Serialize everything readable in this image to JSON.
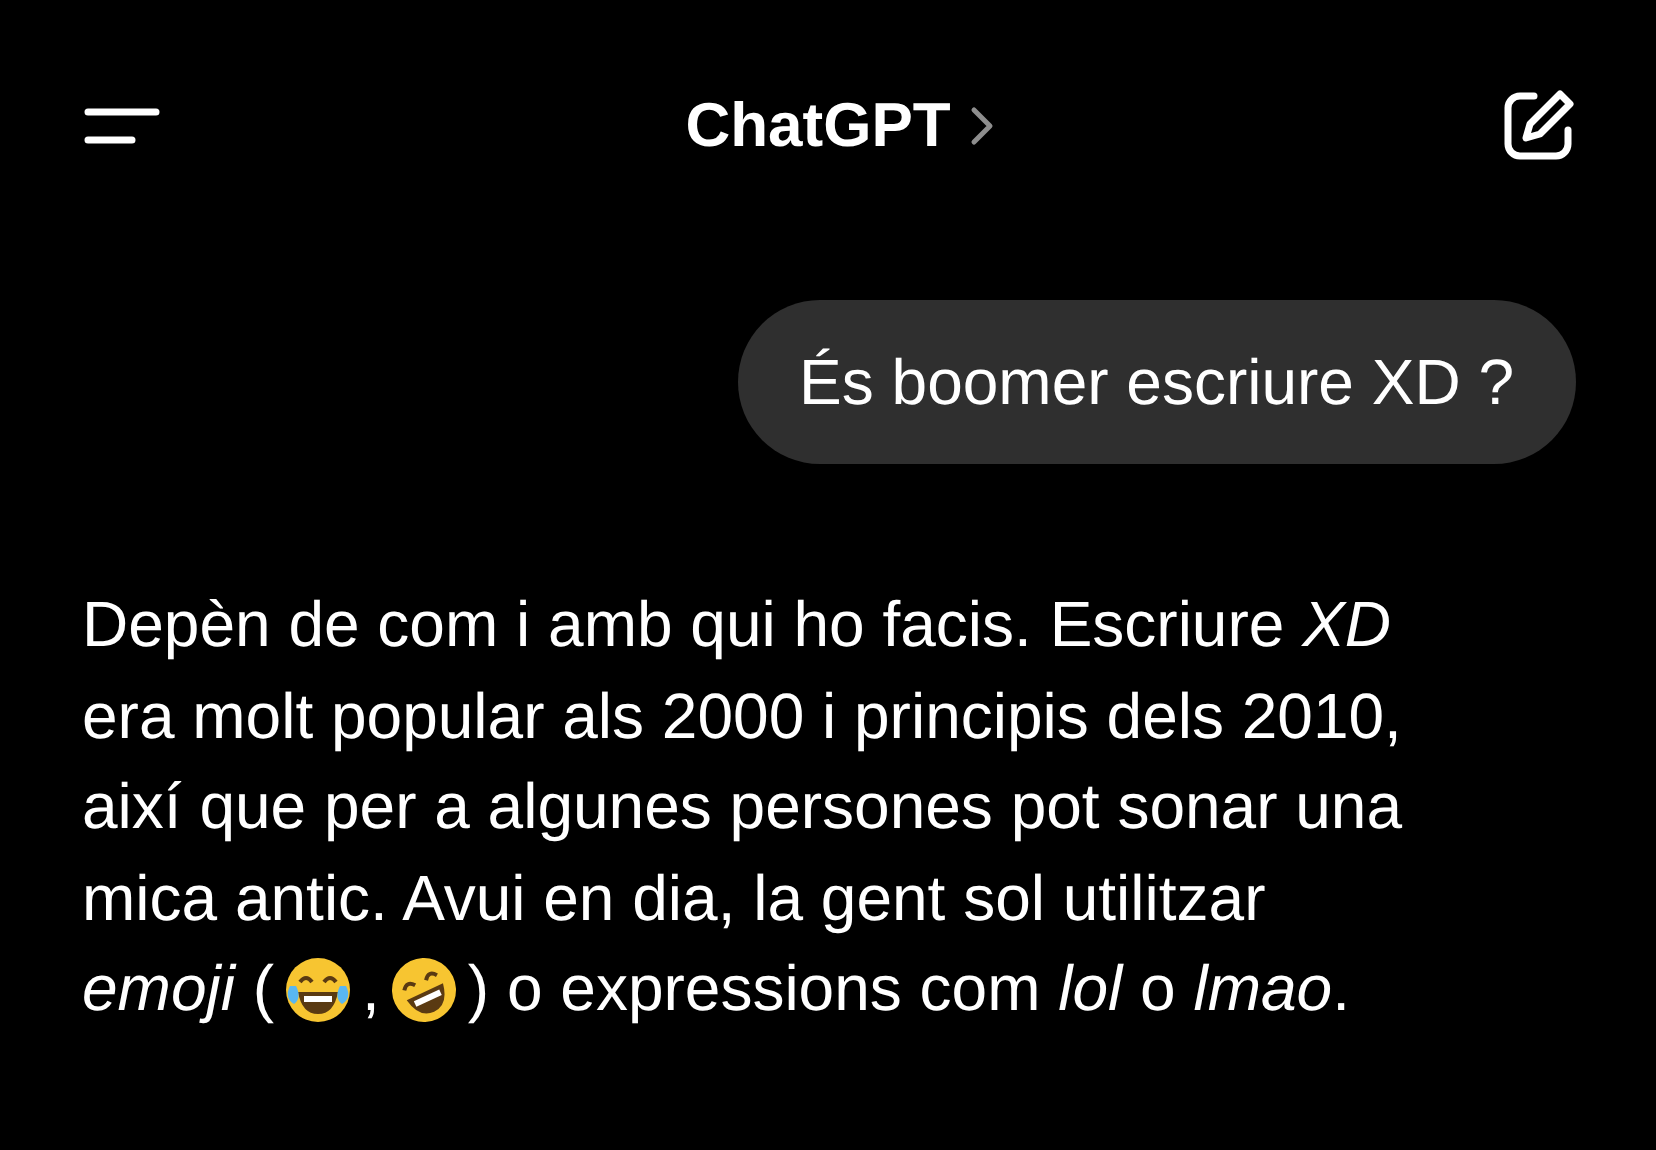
{
  "header": {
    "title": "ChatGPT"
  },
  "messages": [
    {
      "kind": "user",
      "text": "És boomer escriure XD ?"
    },
    {
      "kind": "assistant",
      "lines": [
        [
          {
            "kind": "text",
            "text": "Depèn de com i amb qui ho facis. Escriure *XD*"
          }
        ],
        [
          {
            "kind": "text",
            "text": "era molt popular als 2000 i principis dels 2010,"
          }
        ],
        [
          {
            "kind": "text",
            "text": "així que per a algunes persones pot sonar una"
          }
        ],
        [
          {
            "kind": "text",
            "text": "mica antic. Avui en dia, la gent sol utilitzar"
          }
        ],
        [
          {
            "kind": "text",
            "text": "*emoji* ("
          },
          {
            "kind": "tears-emoji"
          },
          {
            "kind": "text",
            "text": ","
          },
          {
            "kind": "rolling-emoji"
          },
          {
            "kind": "text",
            "text": ") o expressions com *lol* o *lmao*."
          }
        ]
      ]
    }
  ]
}
